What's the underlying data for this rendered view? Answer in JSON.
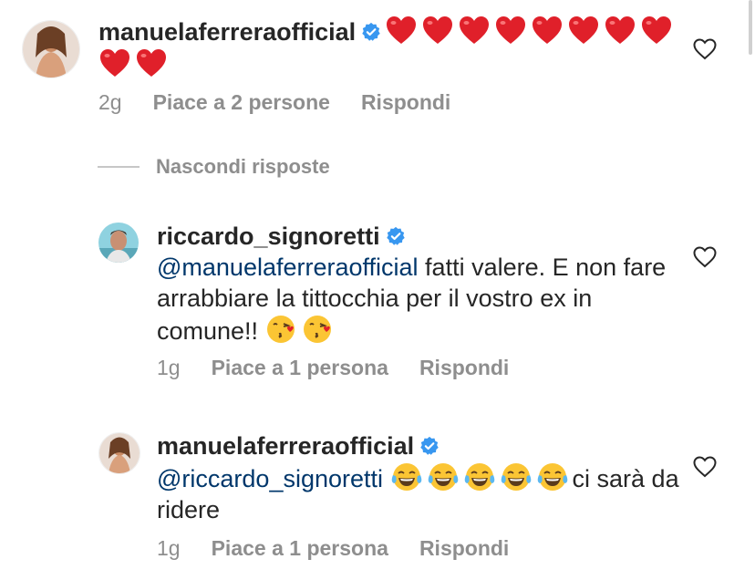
{
  "comments": [
    {
      "username": "manuelaferreraofficial",
      "verified": true,
      "mention": "",
      "text_after_emojis": "",
      "text": "",
      "emojis": [
        "red-heart",
        "red-heart",
        "red-heart",
        "red-heart",
        "red-heart",
        "red-heart",
        "red-heart",
        "red-heart",
        "red-heart",
        "red-heart"
      ],
      "time": "2g",
      "likes": "Piace a 2 persone",
      "reply": "Rispondi"
    },
    {
      "username": "riccardo_signoretti",
      "verified": true,
      "mention": "@manuelaferreraofficial",
      "text": " fatti valere. E non fare arrabbiare la tittocchia per il vostro ex in comune!!",
      "emojis": [
        "kissing-face",
        "kissing-face"
      ],
      "time": "1g",
      "likes": "Piace a 1 persona",
      "reply": "Rispondi"
    },
    {
      "username": "manuelaferreraofficial",
      "verified": true,
      "mention": "@riccardo_signoretti",
      "text": "",
      "emojis": [
        "tears-of-joy",
        "tears-of-joy",
        "tears-of-joy",
        "tears-of-joy",
        "tears-of-joy"
      ],
      "text_after_emojis": "ci sarà da ridere",
      "time": "1g",
      "likes": "Piace a 1 persona",
      "reply": "Rispondi"
    }
  ],
  "hide_replies": "Nascondi risposte",
  "colors": {
    "mention": "#00376b",
    "meta": "#8e8e8e",
    "verified": "#3897f0"
  }
}
